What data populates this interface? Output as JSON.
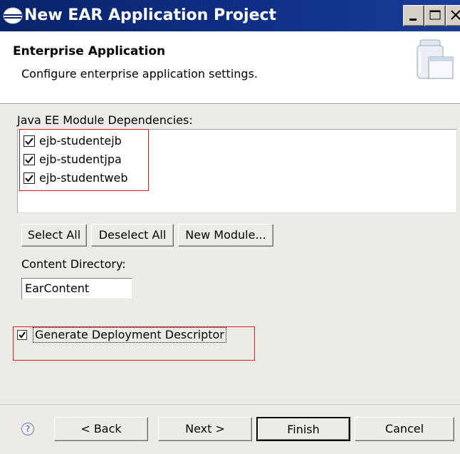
{
  "window": {
    "title": "New EAR Application Project"
  },
  "banner": {
    "heading": "Enterprise Application",
    "description": "Configure enterprise application settings."
  },
  "dependencies": {
    "label": "Java EE Module Dependencies:",
    "items": [
      {
        "label": "ejb-studentejb",
        "checked": true
      },
      {
        "label": "ejb-studentjpa",
        "checked": true
      },
      {
        "label": "ejb-studentweb",
        "checked": true
      }
    ]
  },
  "buttons": {
    "select_all": "Select All",
    "deselect_all": "Deselect All",
    "new_module": "New Module..."
  },
  "content_directory": {
    "label": "Content Directory:",
    "value": "EarContent"
  },
  "generate_descriptor": {
    "label": "Generate Deployment Descriptor",
    "checked": true
  },
  "footer": {
    "help_icon": "question-mark-icon",
    "back": "< Back",
    "next": "Next >",
    "finish": "Finish",
    "cancel": "Cancel"
  },
  "colors": {
    "title_bar": "#0a246a",
    "dialog_bg": "#ecebe6",
    "highlight_box": "#d81e1e"
  }
}
